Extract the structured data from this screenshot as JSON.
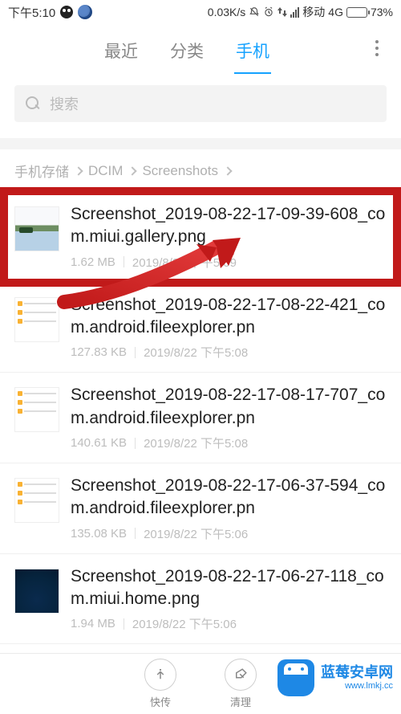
{
  "status": {
    "time": "下午5:10",
    "speed": "0.03K/s",
    "carrier": "移动",
    "network": "4G",
    "battery_pct": "73%"
  },
  "tabs": {
    "items": [
      {
        "label": "最近",
        "active": false
      },
      {
        "label": "分类",
        "active": false
      },
      {
        "label": "手机",
        "active": true
      }
    ]
  },
  "search": {
    "placeholder": "搜索"
  },
  "breadcrumbs": [
    "手机存储",
    "DCIM",
    "Screenshots"
  ],
  "files": [
    {
      "name": "Screenshot_2019-08-22-17-09-39-608_com.miui.gallery.png",
      "size": "1.62 MB",
      "date": "2019/8/22 下午5:09",
      "thumb": "landscape",
      "highlight": true
    },
    {
      "name": "Screenshot_2019-08-22-17-08-22-421_com.android.fileexplorer.pn",
      "size": "127.83 KB",
      "date": "2019/8/22 下午5:08",
      "thumb": "explorer",
      "highlight": false
    },
    {
      "name": "Screenshot_2019-08-22-17-08-17-707_com.android.fileexplorer.pn",
      "size": "140.61 KB",
      "date": "2019/8/22 下午5:08",
      "thumb": "explorer",
      "highlight": false
    },
    {
      "name": "Screenshot_2019-08-22-17-06-37-594_com.android.fileexplorer.pn",
      "size": "135.08 KB",
      "date": "2019/8/22 下午5:06",
      "thumb": "explorer",
      "highlight": false
    },
    {
      "name": "Screenshot_2019-08-22-17-06-27-118_com.miui.home.png",
      "size": "1.94 MB",
      "date": "2019/8/22 下午5:06",
      "thumb": "launcher",
      "highlight": false
    }
  ],
  "bottom": {
    "transfer_label": "快传",
    "clean_label": "清理"
  },
  "watermark": {
    "title": "蓝莓安卓网",
    "url": "www.lmkj.cc"
  }
}
